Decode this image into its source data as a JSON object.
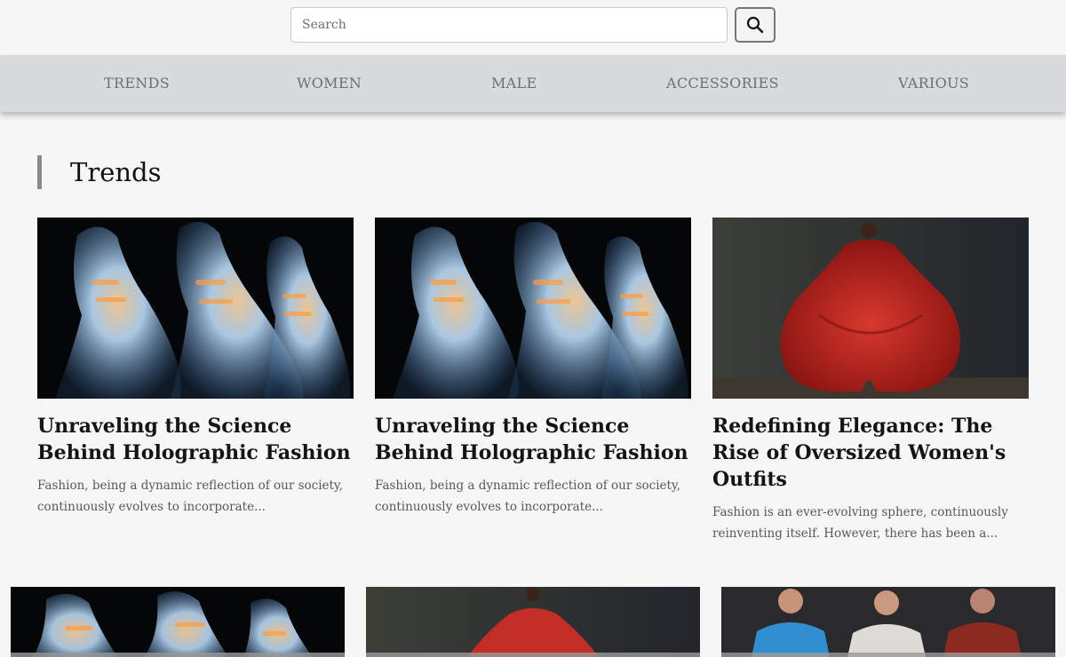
{
  "search": {
    "placeholder": "Search"
  },
  "nav": {
    "items": [
      "TRENDS",
      "WOMEN",
      "MALE",
      "ACCESSORIES",
      "VARIOUS"
    ]
  },
  "section": {
    "title": "Trends"
  },
  "articles": [
    {
      "title": "Unraveling the Science Behind Holographic Fashion",
      "excerpt": "Fashion, being a dynamic reflection of our society, continuously evolves to incorporate..."
    },
    {
      "title": "Unraveling the Science Behind Holographic Fashion",
      "excerpt": "Fashion, being a dynamic reflection of our society, continuously evolves to incorporate..."
    },
    {
      "title": "Redefining Elegance: The Rise of Oversized Women's Outfits",
      "excerpt": "Fashion is an ever-evolving sphere, continuously reinventing itself. However, there has been a..."
    }
  ],
  "colors": {
    "page_background": "#f5f6f5",
    "navbar_background": "#d9dadc",
    "nav_text": "#6c6f74",
    "section_accent": "#8a8a8a"
  },
  "icons": {
    "search_button": "search-icon"
  }
}
